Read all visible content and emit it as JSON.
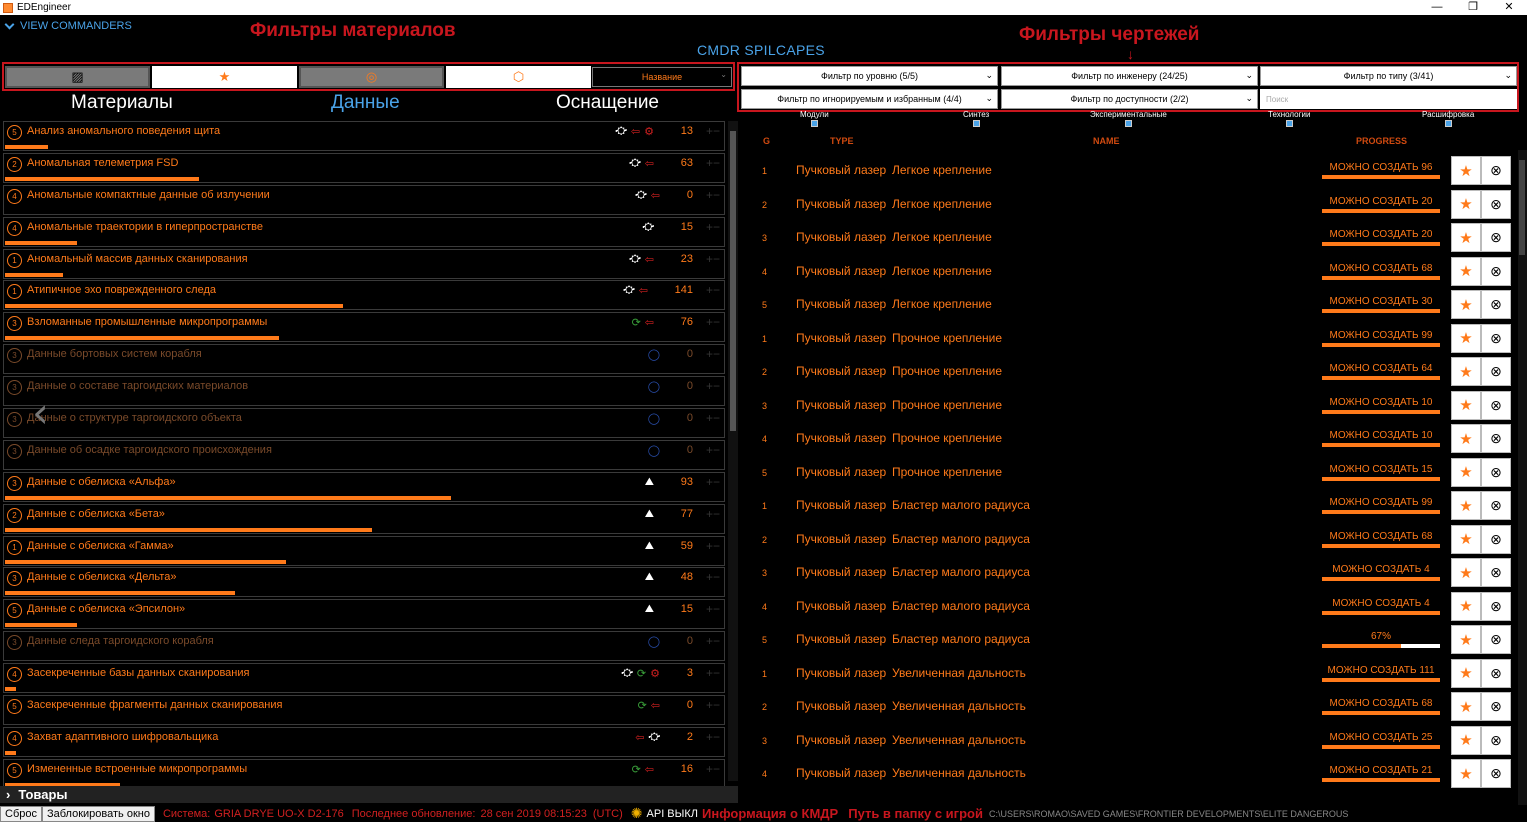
{
  "window": {
    "title": "EDEngineer",
    "minimize": "—",
    "maximize": "❐",
    "close": "✕"
  },
  "view_commanders": "VIEW COMMANDERS",
  "annotations": {
    "materials_filters": "Фильтры материалов",
    "blueprint_filters": "Фильтры чертежей",
    "cmdr_info": "Информация о КМДР",
    "game_path": "Путь в папку с игрой"
  },
  "commander": "CMDR SPILCAPES",
  "material_filter_buttons": [
    {
      "icon": "hatch-icon",
      "glyph": "▨"
    },
    {
      "icon": "star-icon",
      "glyph": "★"
    },
    {
      "icon": "circle-dot-icon",
      "glyph": "◎"
    },
    {
      "icon": "box-icon",
      "glyph": "⬡"
    }
  ],
  "sort_select": {
    "value": "Название",
    "arrow": "⌄"
  },
  "tabs": [
    "Материалы",
    "Данные",
    "Оснащение"
  ],
  "active_tab": "Данные",
  "materials": [
    {
      "name": "Анализ аномального поведения щита",
      "icons": [
        "sat",
        "arrow",
        "gear"
      ],
      "count": "13",
      "progress": 0.06,
      "dim": false,
      "grade": "5"
    },
    {
      "name": "Аномальная телеметрия FSD",
      "icons": [
        "sat",
        "arrow"
      ],
      "count": "63",
      "progress": 0.27,
      "dim": false,
      "grade": "2"
    },
    {
      "name": "Аномальные компактные данные об излучении",
      "icons": [
        "sat",
        "arrow"
      ],
      "count": "0",
      "progress": 0.0,
      "dim": false,
      "grade": "4"
    },
    {
      "name": "Аномальные траектории в гиперпространстве",
      "icons": [
        "sat"
      ],
      "count": "15",
      "progress": 0.1,
      "dim": false,
      "grade": "4"
    },
    {
      "name": "Аномальный массив данных сканирования",
      "icons": [
        "sat",
        "arrow"
      ],
      "count": "23",
      "progress": 0.08,
      "dim": false,
      "grade": "1"
    },
    {
      "name": "Атипичное эхо поврежденного следа",
      "icons": [
        "sat",
        "arrow"
      ],
      "count": "141",
      "progress": 0.47,
      "dim": false,
      "grade": "1"
    },
    {
      "name": "Взломанные промышленные микропрограммы",
      "icons": [
        "grn",
        "arrow"
      ],
      "count": "76",
      "progress": 0.38,
      "dim": false,
      "grade": "3"
    },
    {
      "name": "Данные бортовых систем корабля",
      "icons": [
        "blu"
      ],
      "count": "0",
      "progress": 0.0,
      "dim": true,
      "grade": "3"
    },
    {
      "name": "Данные о составе таргоидских материалов",
      "icons": [
        "blu"
      ],
      "count": "0",
      "progress": 0.0,
      "dim": true,
      "grade": "3"
    },
    {
      "name": "Данные о структуре таргоидского объекта",
      "icons": [
        "blu"
      ],
      "count": "0",
      "progress": 0.0,
      "dim": true,
      "grade": "3"
    },
    {
      "name": "Данные об осадке таргоидского происхождения",
      "icons": [
        "blu"
      ],
      "count": "0",
      "progress": 0.0,
      "dim": true,
      "grade": "3"
    },
    {
      "name": "Данные с обелиска «Альфа»",
      "icons": [
        "ship"
      ],
      "count": "93",
      "progress": 0.62,
      "dim": false,
      "grade": "3"
    },
    {
      "name": "Данные с обелиска «Бета»",
      "icons": [
        "ship"
      ],
      "count": "77",
      "progress": 0.51,
      "dim": false,
      "grade": "2"
    },
    {
      "name": "Данные с обелиска «Гамма»",
      "icons": [
        "ship"
      ],
      "count": "59",
      "progress": 0.39,
      "dim": false,
      "grade": "1"
    },
    {
      "name": "Данные с обелиска «Дельта»",
      "icons": [
        "ship"
      ],
      "count": "48",
      "progress": 0.32,
      "dim": false,
      "grade": "3"
    },
    {
      "name": "Данные с обелиска «Эпсилон»",
      "icons": [
        "ship"
      ],
      "count": "15",
      "progress": 0.1,
      "dim": false,
      "grade": "5"
    },
    {
      "name": "Данные следа таргоидского корабля",
      "icons": [
        "blu"
      ],
      "count": "0",
      "progress": 0.0,
      "dim": true,
      "grade": "3"
    },
    {
      "name": "Засекреченные базы данных сканирования",
      "icons": [
        "sat",
        "grn",
        "gear"
      ],
      "count": "3",
      "progress": 0.015,
      "dim": false,
      "grade": "4"
    },
    {
      "name": "Засекреченные фрагменты данных сканирования",
      "icons": [
        "grn",
        "arrow"
      ],
      "count": "0",
      "progress": 0.0,
      "dim": false,
      "grade": "5"
    },
    {
      "name": "Захват адаптивного шифровальщика",
      "icons": [
        "arrow",
        "sat"
      ],
      "count": "2",
      "progress": 0.015,
      "dim": false,
      "grade": "4"
    },
    {
      "name": "Измененные встроенные микропрограммы",
      "icons": [
        "grn",
        "arrow"
      ],
      "count": "16",
      "progress": 0.16,
      "dim": false,
      "grade": "5"
    }
  ],
  "goods_section": "Товары",
  "blueprint_filters": {
    "level": "Фильтр по уровню (5/5)",
    "engineer": "Фильтр по инженеру (24/25)",
    "type": "Фильтр по типу (3/41)",
    "ignored": "Фильтр по игнорируемым и избранным (4/4)",
    "availability": "Фильтр по доступности (2/2)",
    "search_placeholder": "Поиск"
  },
  "categories": [
    "Модули",
    "Синтез",
    "Экспериментальные",
    "Технологии",
    "Расшифровка"
  ],
  "columns": {
    "grade": "G",
    "type": "TYPE",
    "name": "NAME",
    "progress": "PROGRESS"
  },
  "blueprints": [
    {
      "grade": "1",
      "type": "Пучковый лазер",
      "name": "Легкое крепление",
      "progress": "МОЖНО СОЗДАТЬ 96",
      "fill": 1.0
    },
    {
      "grade": "2",
      "type": "Пучковый лазер",
      "name": "Легкое крепление",
      "progress": "МОЖНО СОЗДАТЬ 20",
      "fill": 1.0
    },
    {
      "grade": "3",
      "type": "Пучковый лазер",
      "name": "Легкое крепление",
      "progress": "МОЖНО СОЗДАТЬ 20",
      "fill": 1.0
    },
    {
      "grade": "4",
      "type": "Пучковый лазер",
      "name": "Легкое крепление",
      "progress": "МОЖНО СОЗДАТЬ 68",
      "fill": 1.0
    },
    {
      "grade": "5",
      "type": "Пучковый лазер",
      "name": "Легкое крепление",
      "progress": "МОЖНО СОЗДАТЬ 30",
      "fill": 1.0
    },
    {
      "grade": "1",
      "type": "Пучковый лазер",
      "name": "Прочное крепление",
      "progress": "МОЖНО СОЗДАТЬ 99",
      "fill": 1.0
    },
    {
      "grade": "2",
      "type": "Пучковый лазер",
      "name": "Прочное крепление",
      "progress": "МОЖНО СОЗДАТЬ 64",
      "fill": 1.0
    },
    {
      "grade": "3",
      "type": "Пучковый лазер",
      "name": "Прочное крепление",
      "progress": "МОЖНО СОЗДАТЬ 10",
      "fill": 1.0
    },
    {
      "grade": "4",
      "type": "Пучковый лазер",
      "name": "Прочное крепление",
      "progress": "МОЖНО СОЗДАТЬ 10",
      "fill": 1.0
    },
    {
      "grade": "5",
      "type": "Пучковый лазер",
      "name": "Прочное крепление",
      "progress": "МОЖНО СОЗДАТЬ 15",
      "fill": 1.0
    },
    {
      "grade": "1",
      "type": "Пучковый лазер",
      "name": "Бластер малого радиуса",
      "progress": "МОЖНО СОЗДАТЬ 99",
      "fill": 1.0
    },
    {
      "grade": "2",
      "type": "Пучковый лазер",
      "name": "Бластер малого радиуса",
      "progress": "МОЖНО СОЗДАТЬ 68",
      "fill": 1.0
    },
    {
      "grade": "3",
      "type": "Пучковый лазер",
      "name": "Бластер малого радиуса",
      "progress": "МОЖНО СОЗДАТЬ 4",
      "fill": 1.0
    },
    {
      "grade": "4",
      "type": "Пучковый лазер",
      "name": "Бластер малого радиуса",
      "progress": "МОЖНО СОЗДАТЬ 4",
      "fill": 1.0
    },
    {
      "grade": "5",
      "type": "Пучковый лазер",
      "name": "Бластер малого радиуса",
      "progress": "67%",
      "fill": 0.67
    },
    {
      "grade": "1",
      "type": "Пучковый лазер",
      "name": "Увеличенная дальность",
      "progress": "МОЖНО СОЗДАТЬ 111",
      "fill": 1.0
    },
    {
      "grade": "2",
      "type": "Пучковый лазер",
      "name": "Увеличенная дальность",
      "progress": "МОЖНО СОЗДАТЬ 68",
      "fill": 1.0
    },
    {
      "grade": "3",
      "type": "Пучковый лазер",
      "name": "Увеличенная дальность",
      "progress": "МОЖНО СОЗДАТЬ 25",
      "fill": 1.0
    },
    {
      "grade": "4",
      "type": "Пучковый лазер",
      "name": "Увеличенная дальность",
      "progress": "МОЖНО СОЗДАТЬ 21",
      "fill": 1.0
    }
  ],
  "fav_glyph": "★",
  "remove_glyph": "⊗",
  "status": {
    "reset": "Сброс",
    "lock": "Заблокировать окно",
    "system_label": "Система:",
    "system": "GRIA DRYE UO-X D2-176",
    "updated_label": "Последнее обновление:",
    "updated": "28 сен 2019 08:15:23",
    "tz": "(UTC)",
    "api": "API ВЫКЛ",
    "path": "C:\\USERS\\ROMAO\\SAVED GAMES\\FRONTIER DEVELOPMENTS\\ELITE DANGEROUS"
  },
  "colors": {
    "accent": "#ff7a1a",
    "blue": "#4aa3e8",
    "annotation": "#c8161e"
  }
}
